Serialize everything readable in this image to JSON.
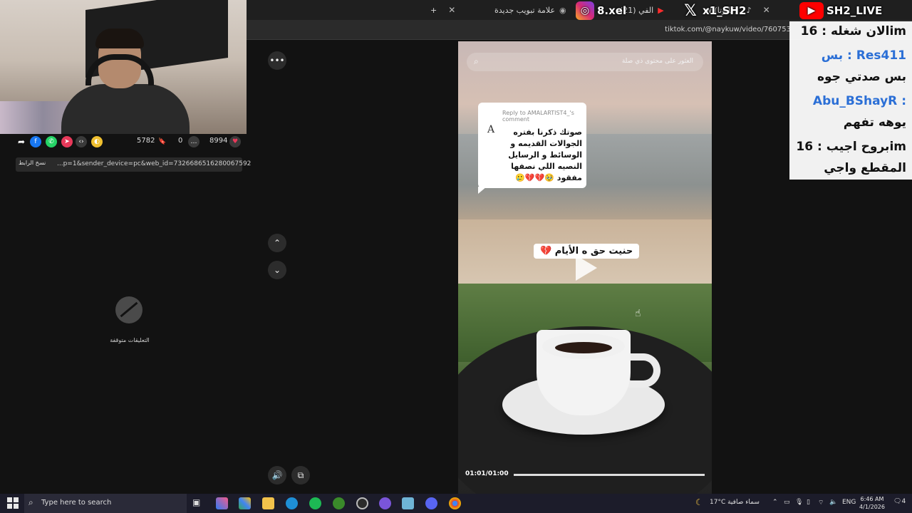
{
  "browser": {
    "tabs": [
      {
        "label": "علامة تبويب جديدة"
      },
      {
        "label": "(21) الفي"
      },
      {
        "label": "w (كايوتا) ـ"
      }
    ],
    "url": "tiktok.com/@naykuw/video/760753"
  },
  "left_panel": {
    "stats": {
      "shares": "5782",
      "saves": "0",
      "comments": "8994"
    },
    "copy_link_label": "نسخ الرابط",
    "copy_link_url": "...p=1&sender_device=pc&web_id=7326686516280067592",
    "comments_off_text": "التعليقات متوقفة"
  },
  "video": {
    "search_placeholder": "العثور على محتوى ذي صلة",
    "reply_header": "Reply to AMALARTIST4_'s comment",
    "reply_avatar": "A",
    "reply_body": "صوتك ذكرنا بفتره الجوالات القديمه و الوسائط و الرسايل النصيه اللي نصفها مفقود 🥹💔💔🥲",
    "caption": "حنيت حق ه الأيام 💔",
    "time": "01:01/01:00"
  },
  "chat": {
    "messages": [
      {
        "text": "الان شغله : 16im"
      },
      {
        "text": "بس : Res411"
      },
      {
        "text": "بس صدتي جوه"
      },
      {
        "text": "Abu_BShayR :"
      },
      {
        "text": "يوهه تفهم"
      },
      {
        "text": "بروح اجيب : 16im"
      },
      {
        "text": "المقطع واجي"
      }
    ]
  },
  "social": {
    "instagram": "8.xel",
    "x": "x1_SH2",
    "youtube": "SH2_LIVE"
  },
  "taskbar": {
    "search_placeholder": "Type here to search",
    "weather": "17°C  سماء صافية",
    "language": "ENG",
    "time": "6:46 AM",
    "date": "4/1/2026",
    "notifications": "4"
  },
  "colors": {
    "heart": "#e8395a",
    "facebook": "#1877f2",
    "whatsapp": "#25d366",
    "instagram": "#d62976",
    "youtube": "#ff0000"
  }
}
